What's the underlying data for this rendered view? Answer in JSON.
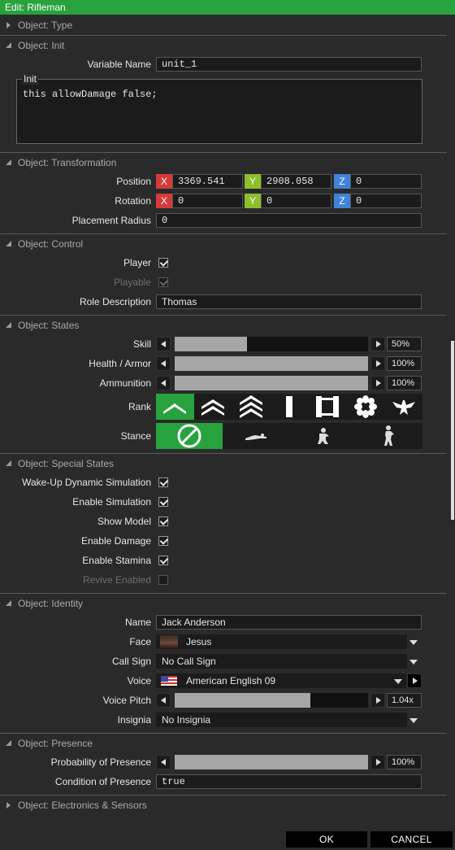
{
  "window": {
    "title": "Edit: Rifleman"
  },
  "sections": {
    "type": "Object: Type",
    "init": "Object: Init",
    "transformation": "Object: Transformation",
    "control": "Object: Control",
    "states": "Object: States",
    "special": "Object: Special States",
    "identity": "Object: Identity",
    "presence": "Object: Presence",
    "electronics": "Object: Electronics & Sensors"
  },
  "init": {
    "variable_label": "Variable Name",
    "variable_value": "unit_1",
    "init_label": "Init",
    "init_code": "this allowDamage false;"
  },
  "transformation": {
    "position_label": "Position",
    "rotation_label": "Rotation",
    "radius_label": "Placement Radius",
    "axis_x": "X",
    "axis_y": "Y",
    "axis_z": "Z",
    "pos_x": "3369.541",
    "pos_y": "2908.058",
    "pos_z": "0",
    "rot_x": "0",
    "rot_y": "0",
    "rot_z": "0",
    "radius": "0"
  },
  "control": {
    "player_label": "Player",
    "player_checked": true,
    "playable_label": "Playable",
    "playable_checked": true,
    "role_label": "Role Description",
    "role_value": "Thomas"
  },
  "states": {
    "skill_label": "Skill",
    "skill_value": "50%",
    "skill_fraction": 0.375,
    "health_label": "Health / Armor",
    "health_value": "100%",
    "health_fraction": 1.0,
    "ammo_label": "Ammunition",
    "ammo_value": "100%",
    "ammo_fraction": 1.0,
    "rank_label": "Rank",
    "ranks": [
      "private-icon",
      "corporal-icon",
      "sergeant-icon",
      "lieutenant-icon",
      "captain-icon",
      "major-icon",
      "colonel-icon"
    ],
    "rank_selected": 0,
    "stance_label": "Stance",
    "stances": [
      "auto-stance-icon",
      "prone-icon",
      "crouch-icon",
      "standing-icon"
    ],
    "stance_selected": 0
  },
  "special": {
    "wake_label": "Wake-Up Dynamic Simulation",
    "sim_label": "Enable Simulation",
    "model_label": "Show Model",
    "damage_label": "Enable Damage",
    "stamina_label": "Enable Stamina",
    "revive_label": "Revive Enabled"
  },
  "identity": {
    "name_label": "Name",
    "name_value": "Jack Anderson",
    "face_label": "Face",
    "face_value": "Jesus",
    "callsign_label": "Call Sign",
    "callsign_value": "No Call Sign",
    "voice_label": "Voice",
    "voice_value": "American English 09",
    "pitch_label": "Voice Pitch",
    "pitch_value": "1.04x",
    "pitch_fraction": 0.7,
    "insignia_label": "Insignia",
    "insignia_value": "No Insignia"
  },
  "presence": {
    "prob_label": "Probability of Presence",
    "prob_value": "100%",
    "prob_fraction": 1.0,
    "cond_label": "Condition of Presence",
    "cond_value": "true"
  },
  "buttons": {
    "ok": "OK",
    "cancel": "CANCEL"
  },
  "colors": {
    "accent": "#27a23c",
    "axis_x": "#d53a3a",
    "axis_y": "#8dbf2b",
    "axis_z": "#3f83d8"
  }
}
